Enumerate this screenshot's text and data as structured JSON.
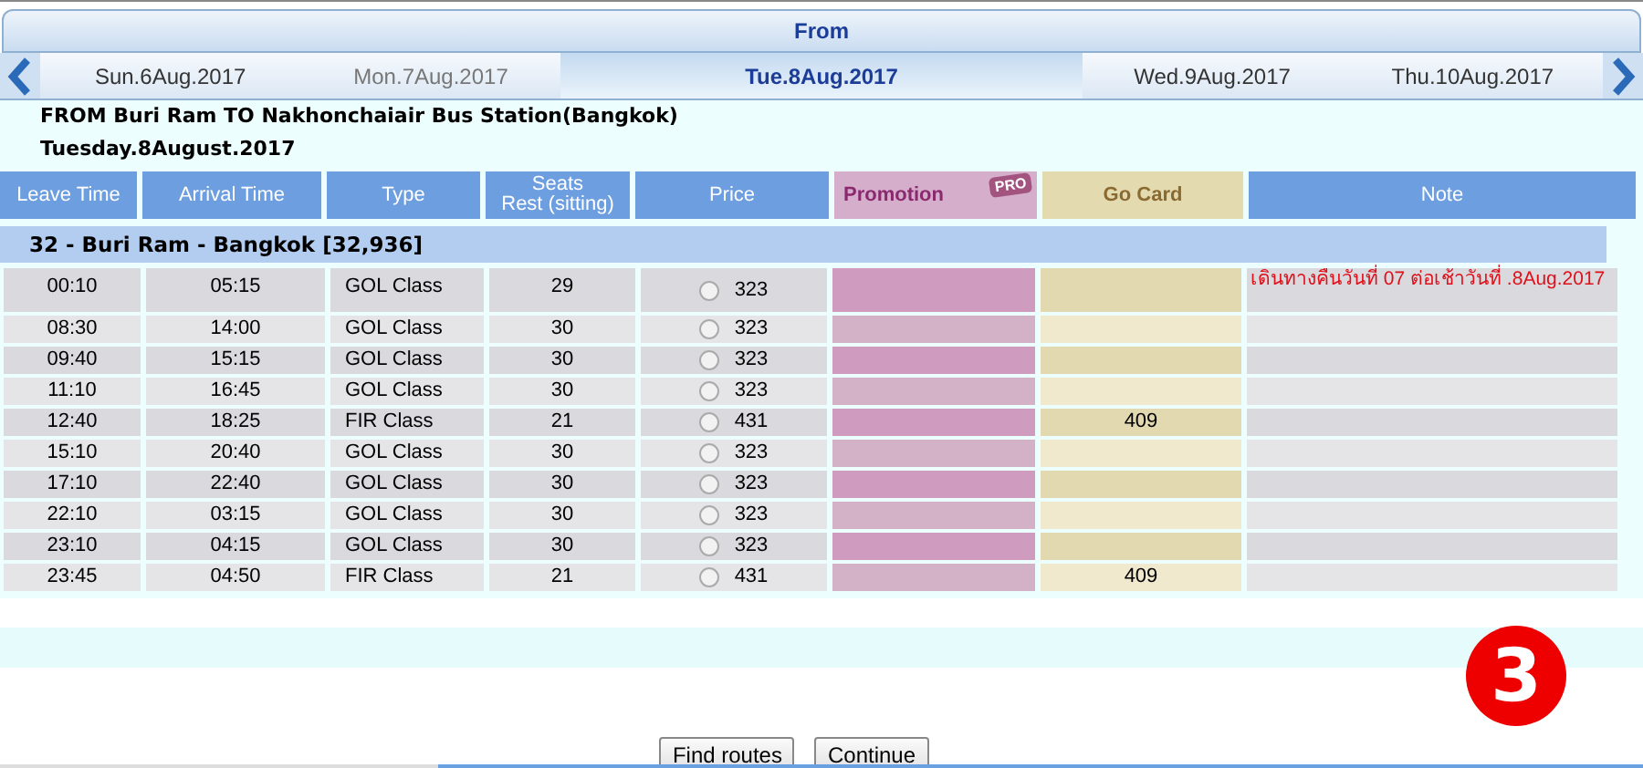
{
  "header": {
    "title": "From"
  },
  "date_tabs": [
    {
      "label": "Sun.6Aug.2017",
      "selected": false
    },
    {
      "label": "Mon.7Aug.2017",
      "selected": false
    },
    {
      "label": "Tue.8Aug.2017",
      "selected": true
    },
    {
      "label": "Wed.9Aug.2017",
      "selected": false
    },
    {
      "label": "Thu.10Aug.2017",
      "selected": false
    }
  ],
  "route_title": "FROM Buri Ram TO Nakhonchaiair Bus Station(Bangkok)",
  "route_date": "Tuesday.8August.2017",
  "columns": [
    {
      "label": "Leave Time",
      "kind": "plain"
    },
    {
      "label": "Arrival Time",
      "kind": "plain"
    },
    {
      "label": "Type",
      "kind": "plain"
    },
    {
      "label": "Seats",
      "sublabel": "Rest (sitting)",
      "kind": "plain"
    },
    {
      "label": "Price",
      "kind": "plain"
    },
    {
      "label": "Promotion",
      "badge": "PRO",
      "kind": "promo"
    },
    {
      "label": "Go Card",
      "kind": "gocard"
    },
    {
      "label": "Note",
      "kind": "plain"
    }
  ],
  "group": "32 - Buri Ram - Bangkok [32,936]",
  "rows": [
    {
      "leave": "00:10",
      "arrive": "05:15",
      "type": "GOL Class",
      "seats": "29",
      "price": "323",
      "selected": false,
      "gocard": "",
      "note": "เดินทางคืนวันที่ 07 ต่อเช้าวันที่ .8Aug.2017"
    },
    {
      "leave": "08:30",
      "arrive": "14:00",
      "type": "GOL Class",
      "seats": "30",
      "price": "323",
      "selected": false,
      "gocard": "",
      "note": ""
    },
    {
      "leave": "09:40",
      "arrive": "15:15",
      "type": "GOL Class",
      "seats": "30",
      "price": "323",
      "selected": false,
      "gocard": "",
      "note": ""
    },
    {
      "leave": "11:10",
      "arrive": "16:45",
      "type": "GOL Class",
      "seats": "30",
      "price": "323",
      "selected": false,
      "gocard": "",
      "note": ""
    },
    {
      "leave": "12:40",
      "arrive": "18:25",
      "type": "FIR Class",
      "seats": "21",
      "price": "431",
      "selected": false,
      "gocard": "409",
      "note": ""
    },
    {
      "leave": "15:10",
      "arrive": "20:40",
      "type": "GOL Class",
      "seats": "30",
      "price": "323",
      "selected": false,
      "gocard": "",
      "note": ""
    },
    {
      "leave": "17:10",
      "arrive": "22:40",
      "type": "GOL Class",
      "seats": "30",
      "price": "323",
      "selected": false,
      "gocard": "",
      "note": ""
    },
    {
      "leave": "22:10",
      "arrive": "03:15",
      "type": "GOL Class",
      "seats": "30",
      "price": "323",
      "selected": false,
      "gocard": "",
      "note": ""
    },
    {
      "leave": "23:10",
      "arrive": "04:15",
      "type": "GOL Class",
      "seats": "30",
      "price": "323",
      "selected": false,
      "gocard": "",
      "note": ""
    },
    {
      "leave": "23:45",
      "arrive": "04:50",
      "type": "FIR Class",
      "seats": "21",
      "price": "431",
      "selected": false,
      "gocard": "409",
      "note": ""
    }
  ],
  "buttons": [
    "Find routes",
    "Continue"
  ],
  "step_badge": "3"
}
